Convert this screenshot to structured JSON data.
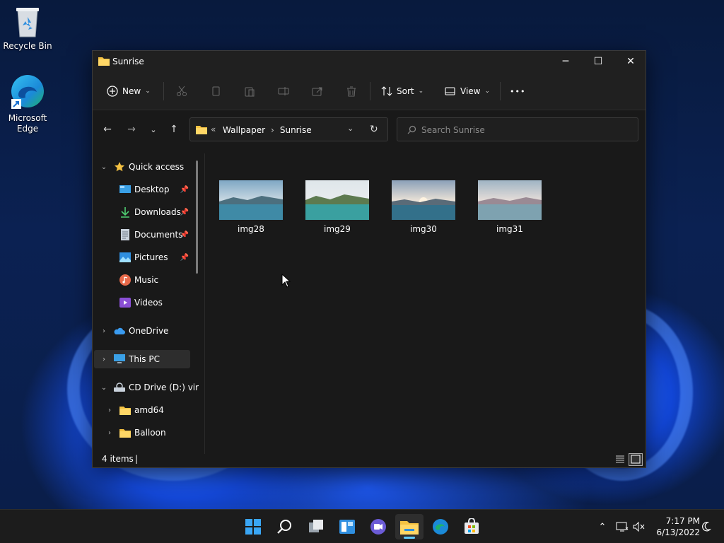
{
  "desktop": {
    "icons": [
      {
        "label": "Recycle Bin"
      },
      {
        "label_line1": "Microsoft",
        "label_line2": "Edge"
      }
    ]
  },
  "window": {
    "title": "Sunrise",
    "controls": {
      "minimize": "─",
      "maximize": "☐",
      "close": "✕"
    }
  },
  "toolbar": {
    "new_label": "New",
    "sort_label": "Sort",
    "view_label": "View",
    "more_label": "•••"
  },
  "address": {
    "overflow": "«",
    "crumbs": [
      "Wallpaper",
      "Sunrise"
    ],
    "separator": "›"
  },
  "search": {
    "placeholder": "Search Sunrise"
  },
  "nav": {
    "quick_access": "Quick access",
    "items": [
      {
        "label": "Desktop",
        "pinned": true
      },
      {
        "label": "Downloads",
        "pinned": true
      },
      {
        "label": "Documents",
        "pinned": true
      },
      {
        "label": "Pictures",
        "pinned": true
      },
      {
        "label": "Music",
        "pinned": false
      },
      {
        "label": "Videos",
        "pinned": false
      }
    ],
    "onedrive": "OneDrive",
    "this_pc": "This PC",
    "cd_drive": "CD Drive (D:) virt",
    "folders": [
      "amd64",
      "Balloon"
    ]
  },
  "files": [
    {
      "name": "img28"
    },
    {
      "name": "img29"
    },
    {
      "name": "img30"
    },
    {
      "name": "img31"
    }
  ],
  "status": {
    "count": "4 items",
    "caret": "|"
  },
  "tray": {
    "time": "7:17 PM",
    "date": "6/13/2022"
  },
  "colors": {
    "accent": "#60cdff",
    "folder": "#f5c242",
    "window_bg": "#191919"
  }
}
